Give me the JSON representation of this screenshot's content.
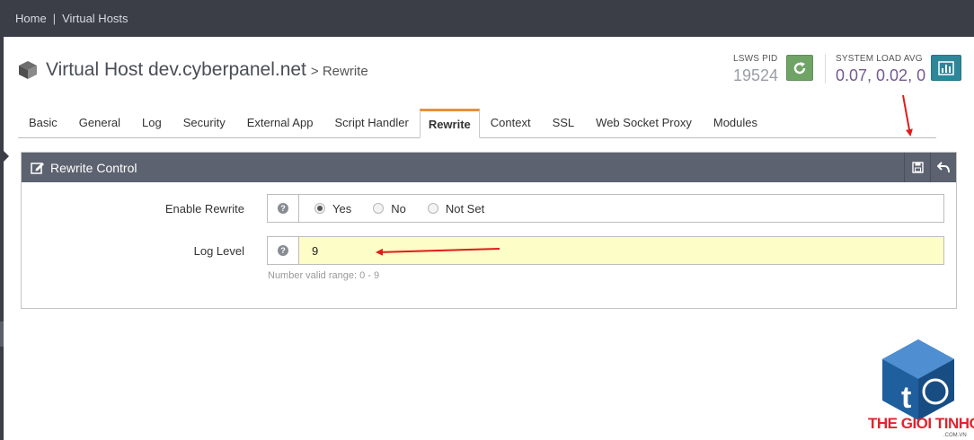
{
  "breadcrumb": {
    "home": "Home",
    "separator": "|",
    "current": "Virtual Hosts"
  },
  "header": {
    "title": "Virtual Host dev.cyberpanel.net",
    "subtitle": "> Rewrite"
  },
  "status": {
    "pid_label": "LSWS PID",
    "pid_value": "19524",
    "load_label": "SYSTEM LOAD AVG",
    "load_value": "0.07, 0.02, 0"
  },
  "tabs": [
    {
      "label": "Basic"
    },
    {
      "label": "General"
    },
    {
      "label": "Log"
    },
    {
      "label": "Security"
    },
    {
      "label": "External App"
    },
    {
      "label": "Script Handler"
    },
    {
      "label": "Rewrite",
      "active": true
    },
    {
      "label": "Context"
    },
    {
      "label": "SSL"
    },
    {
      "label": "Web Socket Proxy"
    },
    {
      "label": "Modules"
    }
  ],
  "panel": {
    "title": "Rewrite Control",
    "enable_rewrite": {
      "label": "Enable Rewrite",
      "options": [
        "Yes",
        "No",
        "Not Set"
      ],
      "selected": "Yes"
    },
    "log_level": {
      "label": "Log Level",
      "value": "9",
      "hint": "Number valid range: 0 - 9"
    }
  },
  "colors": {
    "topbar": "#3b3e47",
    "panel_header": "#5d6270",
    "active_tab_accent": "#e8903a",
    "reload_button": "#6fa466",
    "chart_button": "#2d8799",
    "load_value": "#745a91",
    "log_level_field": "#fcfdc7",
    "annotation_arrow": "#e01b1b",
    "logo_red": "#e3232e",
    "logo_blue": "#1f5f9e"
  },
  "logo": {
    "brand": "THE GIOI TINHOC",
    "domain": ".COM.VN"
  }
}
